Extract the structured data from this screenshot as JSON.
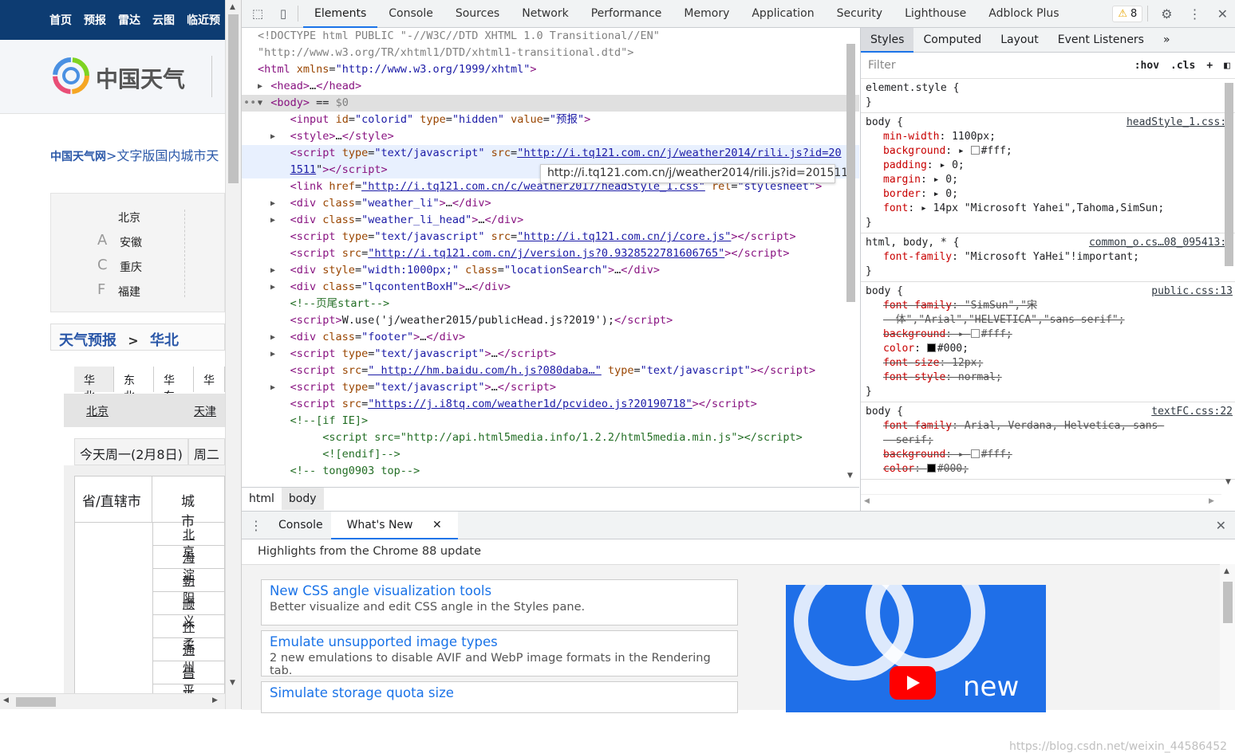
{
  "website": {
    "nav_items": [
      "首页",
      "预报",
      "雷达",
      "云图",
      "临近预"
    ],
    "logo_text": "中国天气",
    "breadcrumb_site": "中国天气网",
    "breadcrumb_rest": ">文字版国内城市天",
    "city_list": [
      {
        "letter": "",
        "city": "北京"
      },
      {
        "letter": "A",
        "city": "安徽"
      },
      {
        "letter": "C",
        "city": "重庆"
      },
      {
        "letter": "F",
        "city": "福建"
      }
    ],
    "forecast_head": "天气预报",
    "forecast_sep": ">",
    "forecast_region": "华北",
    "region_tabs": [
      "华北",
      "东北",
      "华东",
      "华"
    ],
    "city_bar": [
      "北京",
      "天津"
    ],
    "day_tabs": [
      "今天周一(2月8日)",
      "周二"
    ],
    "table_header": [
      "省/直辖市",
      "城市"
    ],
    "table_cities": [
      "北京",
      "海淀",
      "朝阳",
      "顺义",
      "怀柔",
      "通州",
      "昌平",
      "延庆"
    ]
  },
  "devtools": {
    "tabs": [
      "Elements",
      "Console",
      "Sources",
      "Network",
      "Performance",
      "Memory",
      "Application",
      "Security",
      "Lighthouse",
      "Adblock Plus"
    ],
    "active_tab": "Elements",
    "warning_count": "8",
    "tooltip_url": "http://i.tq121.com.cn/j/weather2014/rili.js?id=201511",
    "breadcrumbs": [
      "html",
      "body"
    ],
    "styles_tabs": [
      "Styles",
      "Computed",
      "Layout",
      "Event Listeners"
    ],
    "filter_placeholder": "Filter",
    "hov_label": ":hov",
    "cls_label": ".cls",
    "drawer_tabs": [
      "Console",
      "What's New"
    ],
    "whats_new_title": "Highlights from the Chrome 88 update",
    "features": [
      {
        "title": "New CSS angle visualization tools",
        "desc": "Better visualize and edit CSS angle in the Styles pane."
      },
      {
        "title": "Emulate unsupported image types",
        "desc": "2 new emulations to disable AVIF and WebP image formats in the Rendering tab."
      },
      {
        "title": "Simulate storage quota size",
        "desc": ""
      }
    ],
    "video_text": "new",
    "watermark": "https://blog.csdn.net/weixin_44586452"
  },
  "colors": {
    "accent": "#1a73e8",
    "site_nav": "#0d3c72",
    "site_link": "#2a57a8",
    "warning": "#e8a600"
  }
}
